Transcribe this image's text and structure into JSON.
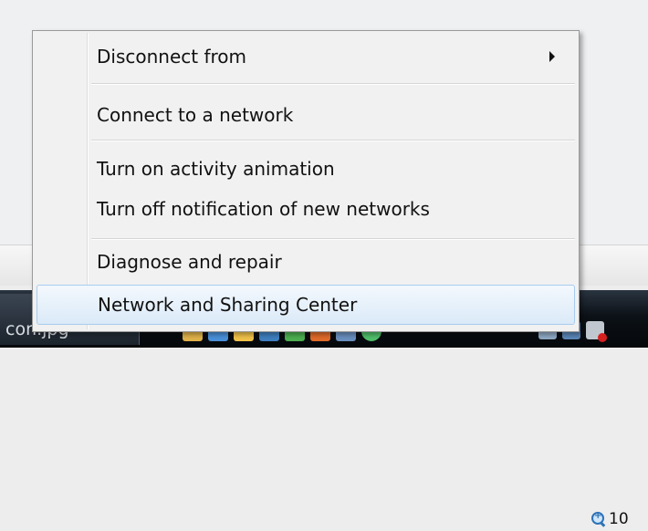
{
  "menu": {
    "items": [
      {
        "label": "Disconnect from",
        "has_submenu": true
      },
      {
        "label": "Connect to a network"
      },
      {
        "label": "Turn on activity animation"
      },
      {
        "label": "Turn off notification of new networks"
      },
      {
        "label": "Diagnose and repair"
      },
      {
        "label": "Network and Sharing Center",
        "highlighted": true
      }
    ]
  },
  "statusbar": {
    "zoom_text": "10",
    "zoom_icon": "zoom-in-icon"
  },
  "taskbar": {
    "task_label": "con.jpg",
    "task_ellipsis": "...",
    "quicklaunch_icons": [
      "folder-icon",
      "window-icon",
      "mail-icon",
      "media-icon",
      "leaf-icon",
      "photo-icon",
      "windows-icon",
      "globe-icon"
    ],
    "tray_icons": [
      "display-icon",
      "network-icon",
      "volume-muted-icon"
    ]
  },
  "colors": {
    "highlight_border": "#a8cbef",
    "menu_background": "#f1f1f1",
    "taskbar": "#0c1117"
  }
}
